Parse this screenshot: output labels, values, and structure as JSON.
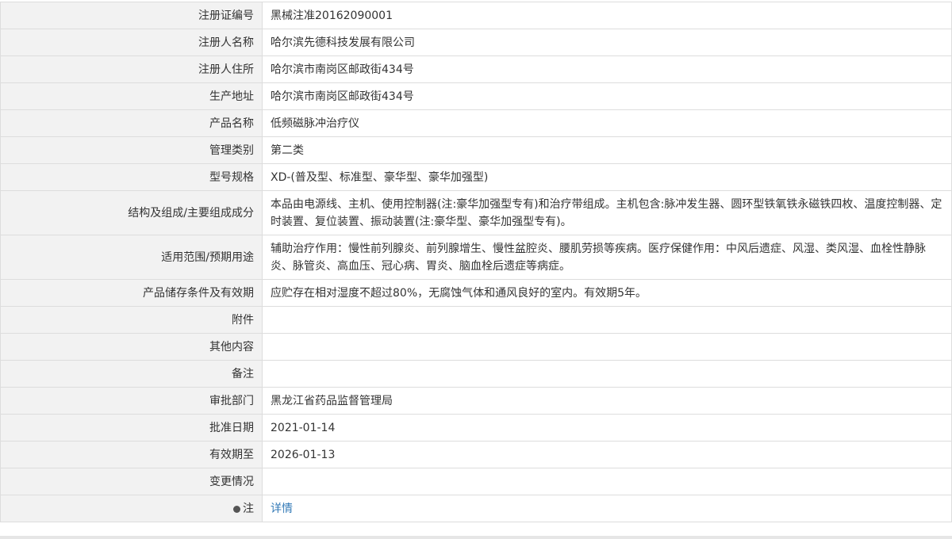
{
  "rows": [
    {
      "label": "注册证编号",
      "value": "黑械注准20162090001"
    },
    {
      "label": "注册人名称",
      "value": "哈尔滨先德科技发展有限公司"
    },
    {
      "label": "注册人住所",
      "value": "哈尔滨市南岗区邮政街434号"
    },
    {
      "label": "生产地址",
      "value": "哈尔滨市南岗区邮政街434号"
    },
    {
      "label": "产品名称",
      "value": "低频磁脉冲治疗仪"
    },
    {
      "label": "管理类别",
      "value": "第二类"
    },
    {
      "label": "型号规格",
      "value": "XD-(普及型、标准型、豪华型、豪华加强型)"
    },
    {
      "label": "结构及组成/主要组成成分",
      "value": "本品由电源线、主机、使用控制器(注:豪华加强型专有)和治疗带组成。主机包含:脉冲发生器、圆环型铁氧铁永磁铁四枚、温度控制器、定时装置、复位装置、振动装置(注:豪华型、豪华加强型专有)。"
    },
    {
      "label": "适用范围/预期用途",
      "value": "辅助治疗作用：慢性前列腺炎、前列腺增生、慢性盆腔炎、腰肌劳损等疾病。医疗保健作用：中风后遗症、风湿、类风湿、血栓性静脉炎、脉管炎、高血压、冠心病、胃炎、脑血栓后遗症等病症。"
    },
    {
      "label": "产品储存条件及有效期",
      "value": "应贮存在相对湿度不超过80%，无腐蚀气体和通风良好的室内。有效期5年。"
    },
    {
      "label": "附件",
      "value": ""
    },
    {
      "label": "其他内容",
      "value": ""
    },
    {
      "label": "备注",
      "value": ""
    },
    {
      "label": "审批部门",
      "value": "黑龙江省药品监督管理局"
    },
    {
      "label": "批准日期",
      "value": "2021-01-14"
    },
    {
      "label": "有效期至",
      "value": "2026-01-13"
    },
    {
      "label": "变更情况",
      "value": ""
    }
  ],
  "note": {
    "label": "注",
    "icon": "pin-icon",
    "link_text": "详情"
  }
}
